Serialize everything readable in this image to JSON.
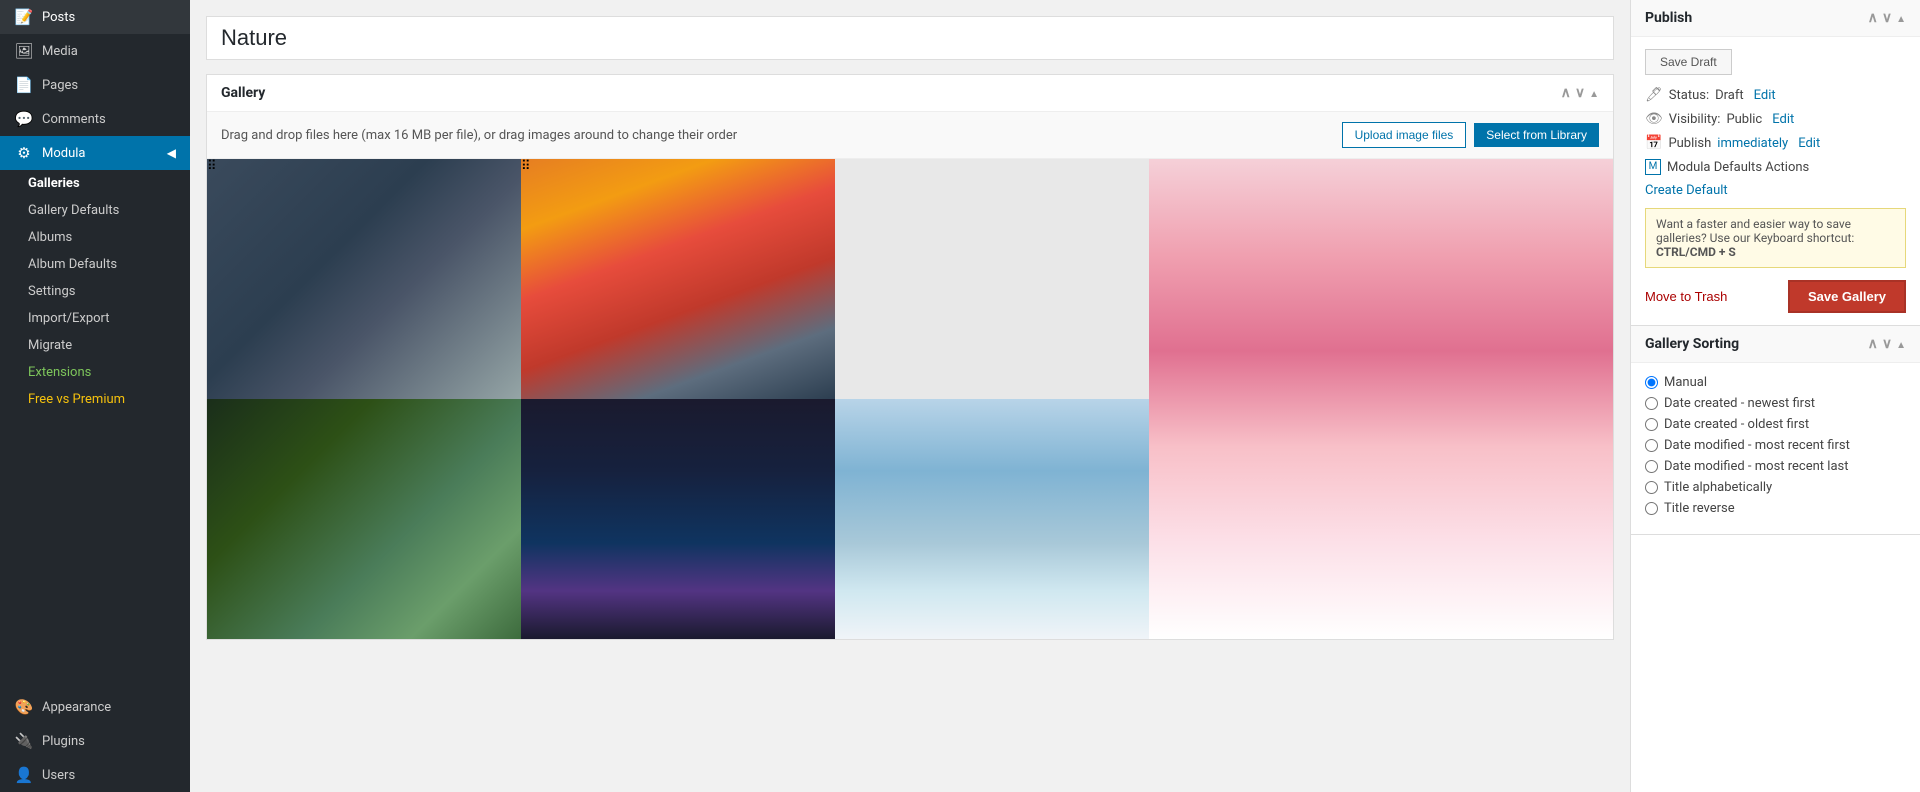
{
  "sidebar": {
    "items": [
      {
        "id": "posts",
        "label": "Posts",
        "icon": "📝"
      },
      {
        "id": "media",
        "label": "Media",
        "icon": "🖼"
      },
      {
        "id": "pages",
        "label": "Pages",
        "icon": "📄"
      },
      {
        "id": "comments",
        "label": "Comments",
        "icon": "💬"
      },
      {
        "id": "modula",
        "label": "Modula",
        "icon": "⚙"
      }
    ],
    "modula_sub": [
      {
        "id": "galleries",
        "label": "Galleries",
        "active": true,
        "style": "normal"
      },
      {
        "id": "gallery-defaults",
        "label": "Gallery Defaults",
        "style": "normal"
      },
      {
        "id": "albums",
        "label": "Albums",
        "style": "normal"
      },
      {
        "id": "album-defaults",
        "label": "Album Defaults",
        "style": "normal"
      },
      {
        "id": "settings",
        "label": "Settings",
        "style": "normal"
      },
      {
        "id": "import-export",
        "label": "Import/Export",
        "style": "normal"
      },
      {
        "id": "migrate",
        "label": "Migrate",
        "style": "normal"
      },
      {
        "id": "extensions",
        "label": "Extensions",
        "style": "green"
      },
      {
        "id": "free-vs-premium",
        "label": "Free vs Premium",
        "style": "yellow"
      }
    ],
    "bottom_items": [
      {
        "id": "appearance",
        "label": "Appearance",
        "icon": "🎨"
      },
      {
        "id": "plugins",
        "label": "Plugins",
        "icon": "🔌"
      },
      {
        "id": "users",
        "label": "Users",
        "icon": "👤"
      }
    ]
  },
  "page": {
    "title": "Nature",
    "title_placeholder": "Enter gallery title"
  },
  "gallery_panel": {
    "title": "Gallery",
    "toolbar_text": "Drag and drop files here (max 16 MB per file), or drag images around to change their order",
    "btn_upload": "Upload image files",
    "btn_library": "Select from Library"
  },
  "publish_panel": {
    "title": "Publish",
    "btn_save_draft": "Save Draft",
    "status_label": "Status:",
    "status_value": "Draft",
    "status_edit": "Edit",
    "visibility_label": "Visibility:",
    "visibility_value": "Public",
    "visibility_edit": "Edit",
    "publish_label": "Publish",
    "publish_value": "immediately",
    "publish_edit": "Edit",
    "modula_defaults": "Modula Defaults Actions",
    "create_default": "Create Default",
    "keyboard_hint": "Want a faster and easier way to save galleries? Use our Keyboard shortcut:",
    "keyboard_shortcut": "CTRL/CMD + S",
    "btn_move_trash": "Move to Trash",
    "btn_save_gallery": "Save Gallery"
  },
  "gallery_sorting_panel": {
    "title": "Gallery Sorting",
    "options": [
      {
        "id": "manual",
        "label": "Manual",
        "checked": true
      },
      {
        "id": "date-newest",
        "label": "Date created - newest first",
        "checked": false
      },
      {
        "id": "date-oldest",
        "label": "Date created - oldest first",
        "checked": false
      },
      {
        "id": "date-mod-recent-first",
        "label": "Date modified - most recent first",
        "checked": false
      },
      {
        "id": "date-mod-recent-last",
        "label": "Date modified - most recent last",
        "checked": false
      },
      {
        "id": "title-alpha",
        "label": "Title alphabetically",
        "checked": false
      },
      {
        "id": "title-reverse",
        "label": "Title reverse",
        "checked": false
      }
    ]
  }
}
